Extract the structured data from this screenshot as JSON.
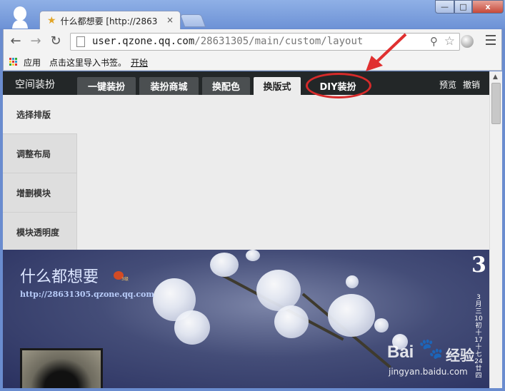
{
  "browser": {
    "tab_title": "什么都想要 [http://2863",
    "tab_close": "×",
    "window_min": "—",
    "window_max": "□",
    "window_close": "x",
    "url_host": "user.qzone.qq.com",
    "url_path": "/28631305/main/custom/layout"
  },
  "bookmarks": {
    "apps": "应用",
    "import_hint": "点击这里导入书签。",
    "start": "开始"
  },
  "diy": {
    "title": "空间装扮",
    "tabs": [
      "一键装扮",
      "装扮商城",
      "换配色",
      "换版式",
      "DIY装扮"
    ],
    "active_tab": "换版式",
    "preview": "预览",
    "undo": "撤销"
  },
  "side_menu": [
    "选择排版",
    "调整布局",
    "增删模块",
    "模块透明度"
  ],
  "banner": {
    "title": "什么都想要",
    "badge": "3级",
    "url": "http://28631305.qzone.qq.com",
    "calendar_big": "3",
    "calendar_col": [
      "3",
      "月",
      "三",
      "10",
      "初",
      "十",
      "17",
      "十",
      "七",
      "24",
      "廿",
      "四"
    ]
  },
  "watermark": {
    "logo_left": "Bai",
    "logo_right": "经验",
    "url": "jingyan.baidu.com"
  },
  "colors": {
    "annotation": "#d62a2a",
    "diybar": "#232728",
    "banner": "#444d78"
  }
}
